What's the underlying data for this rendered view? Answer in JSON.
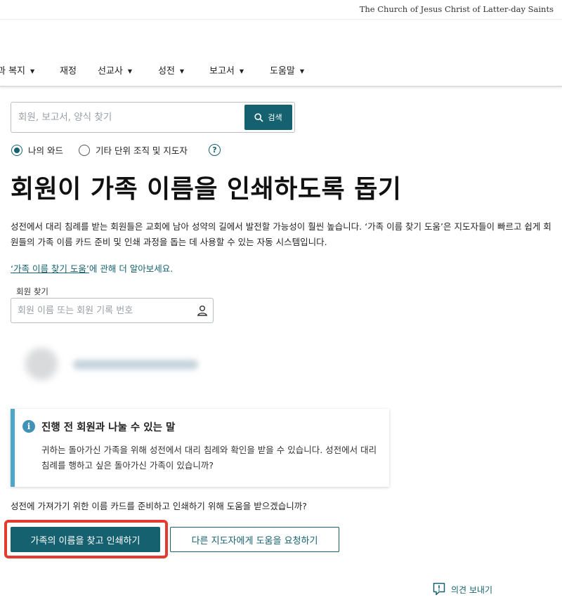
{
  "brand": "The Church of Jesus Christ of Latter-day Saints",
  "nav": {
    "items": [
      {
        "label": "과 복지",
        "dropdown": true
      },
      {
        "label": "재정",
        "dropdown": false
      },
      {
        "label": "선교사",
        "dropdown": true
      },
      {
        "label": "성전",
        "dropdown": true
      },
      {
        "label": "보고서",
        "dropdown": true
      },
      {
        "label": "도움말",
        "dropdown": true
      }
    ]
  },
  "search": {
    "placeholder": "회원, 보고서, 양식 찾기",
    "button_label": "검색"
  },
  "scope": {
    "option_mine": "나의 와드",
    "option_other": "기타 단위 조직 및 지도자",
    "selected": "나의 와드"
  },
  "page": {
    "title": "회원이 가족 이름을 인쇄하도록 돕기",
    "description": "성전에서 대리 침례를 받는 회원들은 교회에 남아 성약의 길에서 발전할 가능성이 훨씬 높습니다. ‘가족 이름 찾기 도움’은 지도자들이 빠르고 쉽게 회원들의 가족 이름 카드 준비 및 인쇄 과정을 돕는 데 사용할 수 있는 자동 시스템입니다.",
    "learn_more_link": "‘가족 이름 찾기 도움’",
    "learn_more_rest": "에 관해 더 알아보세요."
  },
  "member_search": {
    "label": "회원 찾기",
    "placeholder": "회원 이름 또는 회원 기록 번호"
  },
  "notice": {
    "title": "진행 전 회원과 나눌 수 있는 말",
    "body": "귀하는 돌아가신 가족을 위해 성전에서 대리 침례와 확인을 받을 수 있습니다. 성전에서 대리 침례를 행하고 싶은 돌아가신 가족이 있습니까?"
  },
  "question": "성전에 가져가기 위한 이름 카드를 준비하고 인쇄하기 위해 도움을 받으겠습니까?",
  "buttons": {
    "primary": "가족의 이름을 찾고 인쇄하기",
    "secondary": "다른 지도자에게 도움을 요청하기"
  },
  "feedback": "의견 보내기",
  "colors": {
    "accent": "#15616f",
    "info": "#4ea6c8",
    "highlight": "#e53a30"
  }
}
